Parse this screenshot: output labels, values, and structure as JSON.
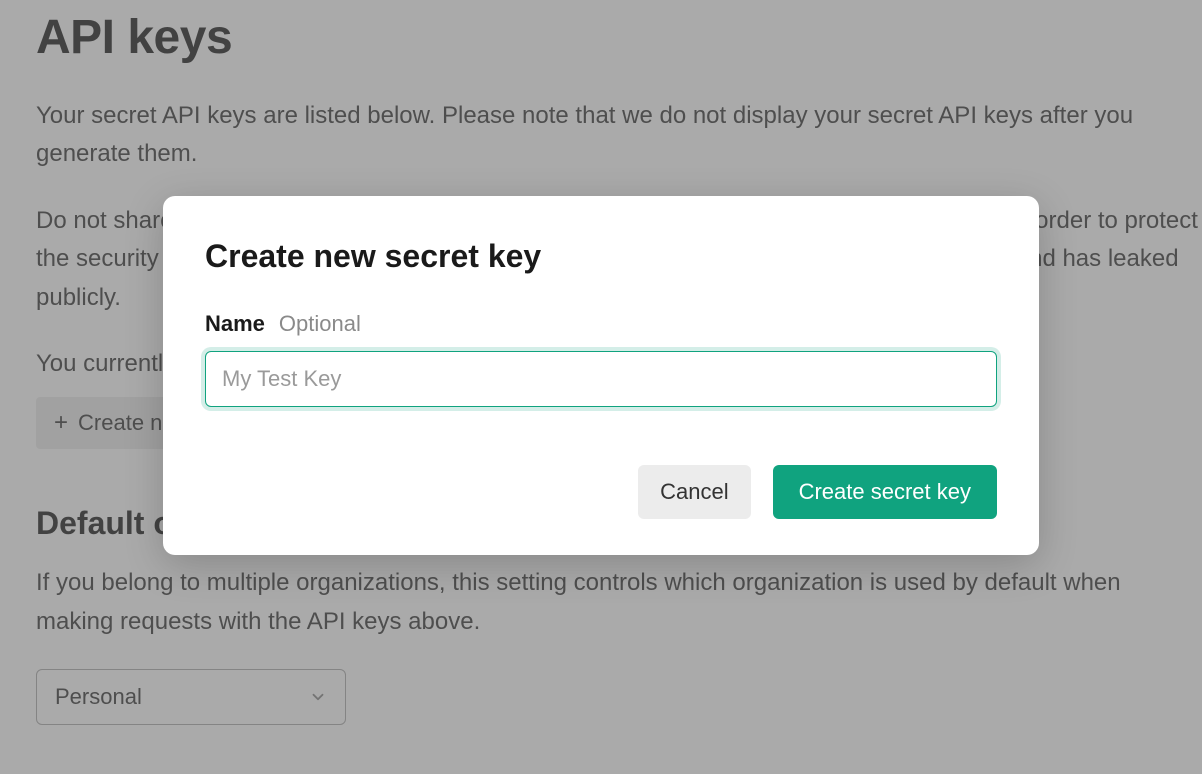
{
  "page": {
    "title": "API keys",
    "desc1": "Your secret API keys are listed below. Please note that we do not display your secret API keys after you generate them.",
    "desc2": "Do not share your API key with others, or expose it in the browser or other client-side code. In order to protect the security of your account, OpenAI may also automatically rotate any API key that we've found has leaked publicly.",
    "desc3": "You currently do not have any API keys. Please create one below.",
    "create_button_label": "Create new secret key",
    "section_title": "Default organizations",
    "org_desc": "If you belong to multiple organizations, this setting controls which organization is used by default when making requests with the API keys above.",
    "org_select_value": "Personal"
  },
  "modal": {
    "title": "Create new secret key",
    "field_label": "Name",
    "field_hint": "Optional",
    "input_placeholder": "My Test Key",
    "input_value": "",
    "cancel_label": "Cancel",
    "submit_label": "Create secret key"
  },
  "colors": {
    "accent": "#10a37f"
  }
}
